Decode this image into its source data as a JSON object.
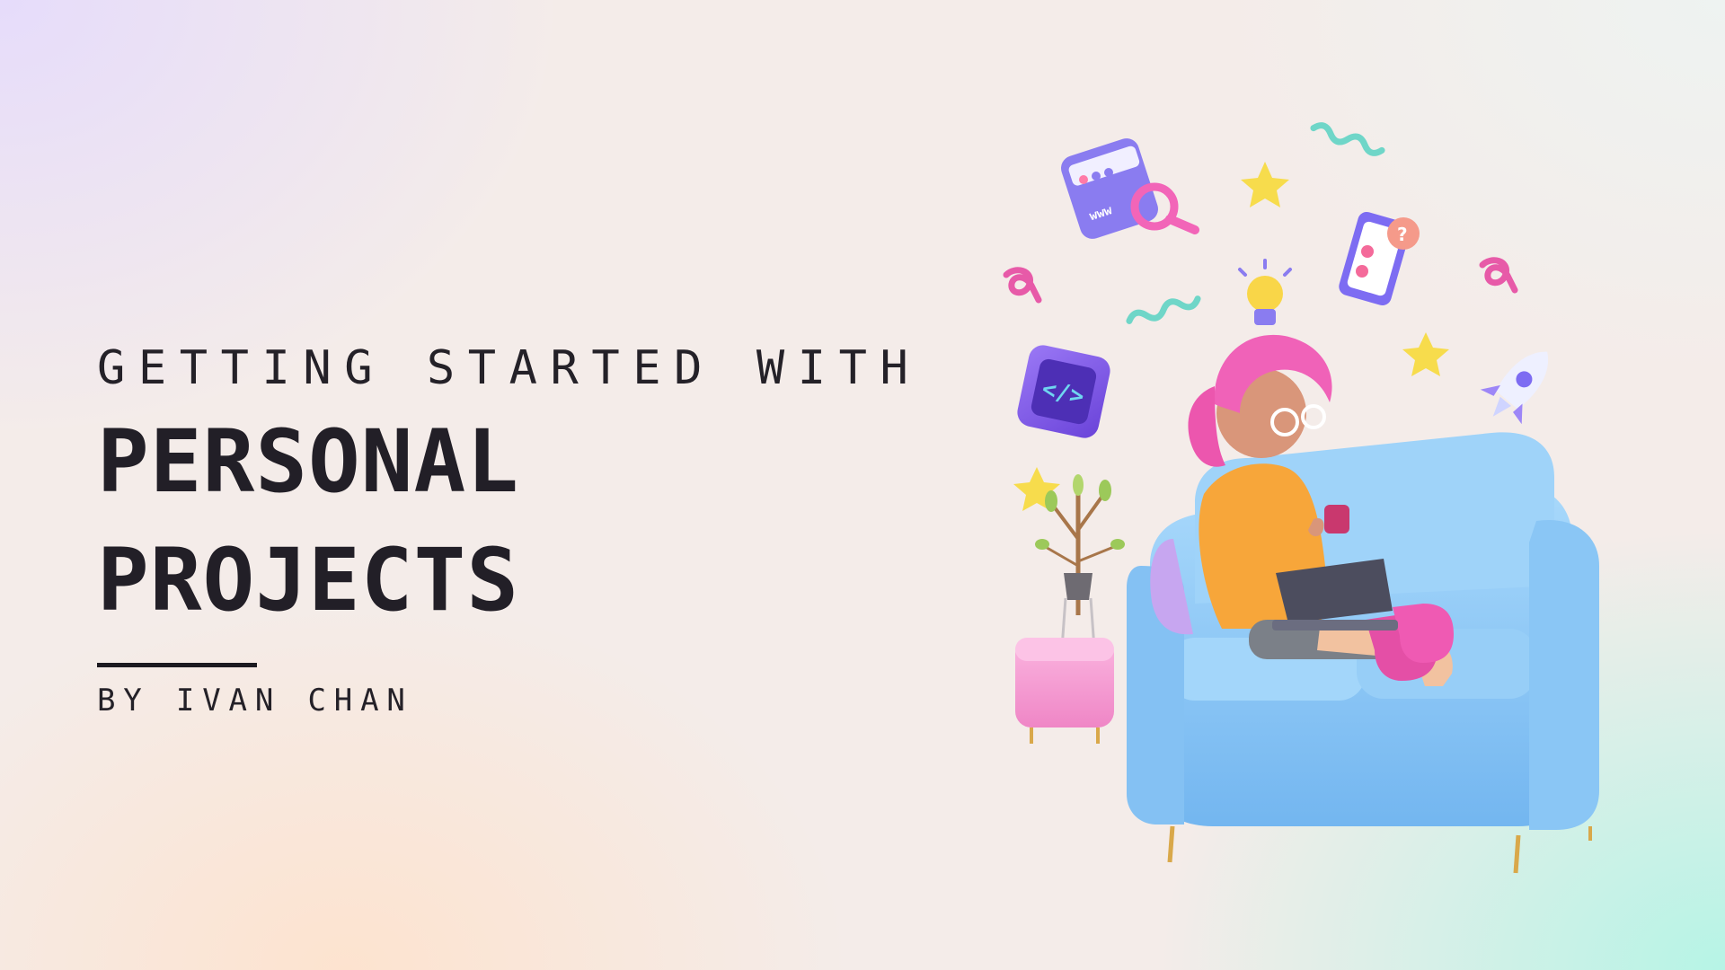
{
  "subtitle": "GETTING STARTED WITH",
  "title_line_1": "PERSONAL",
  "title_line_2": "PROJECTS",
  "byline": "BY IVAN CHAN",
  "browser_icon_text": "www",
  "illustration_subject": "person-on-sofa-with-laptop",
  "colors": {
    "sofa": "#8ec9f6",
    "hair": "#f062b8",
    "sweater": "#f7a63a",
    "stool": "#f59ad2",
    "code_icon": "#7b56e8",
    "star": "#f7dc4c",
    "squiggle": "#6fd6c8"
  }
}
